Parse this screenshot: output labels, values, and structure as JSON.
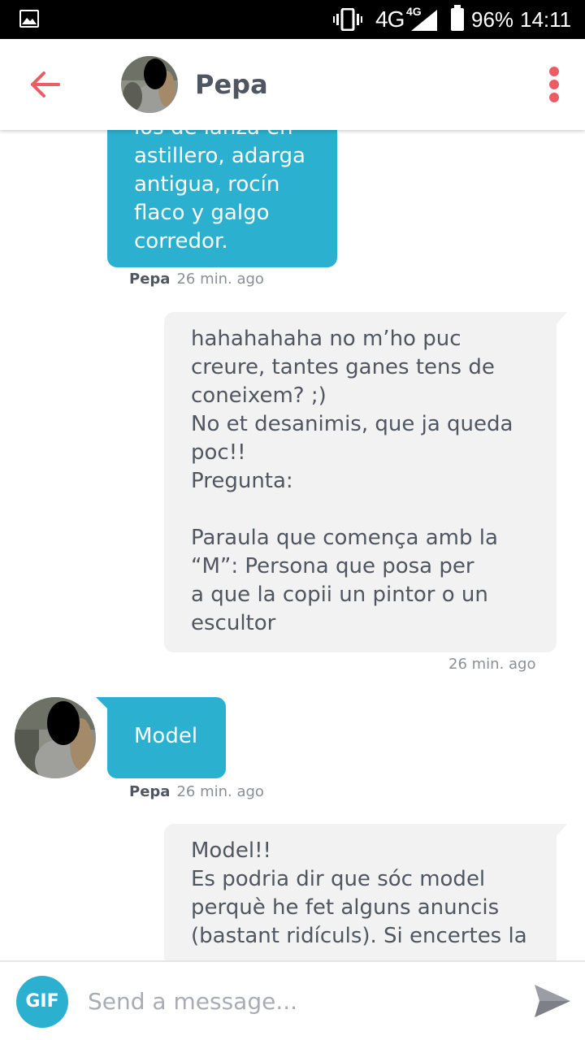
{
  "status_bar": {
    "network": "4G",
    "network_secondary": "4G",
    "battery": "96%",
    "time": "14:11",
    "icons": [
      "image-notification-icon",
      "vibrate-icon",
      "signal-icon",
      "battery-icon"
    ]
  },
  "header": {
    "contact_name": "Pepa",
    "icons": [
      "back-arrow-icon",
      "avatar",
      "more-vert-icon"
    ]
  },
  "colors": {
    "accent": "#ec5c64",
    "incoming_bubble": "#2bb1cf",
    "outgoing_bubble": "#f2f2f2",
    "text": "#505660",
    "meta": "#8a8f96"
  },
  "messages": [
    {
      "direction": "incoming",
      "lines": [
        "los de lanza en",
        "astillero, adarga",
        "antigua, rocín",
        "flaco y galgo",
        "corredor."
      ],
      "sender": "Pepa",
      "time": "26 min. ago"
    },
    {
      "direction": "outgoing",
      "lines": [
        "hahahahaha no m’ho puc",
        "creure, tantes ganes tens de",
        "coneixem? ;)",
        "No et desanimis, que ja queda",
        "poc!!",
        "Pregunta:",
        "",
        "Paraula que comença amb la",
        "“M”: Persona que posa per",
        "a que la copii un pintor o un",
        "escultor"
      ],
      "time": "26 min. ago"
    },
    {
      "direction": "incoming",
      "lines": [
        "Model"
      ],
      "sender": "Pepa",
      "time": "26 min. ago"
    },
    {
      "direction": "outgoing",
      "lines": [
        "Model!!",
        "Es podria dir que sóc model",
        "perquè he fet alguns anuncis",
        "(bastant ridículs). Si encertes la"
      ]
    }
  ],
  "input": {
    "gif_label": "GIF",
    "placeholder": "Send a message...",
    "icons": [
      "gif-button",
      "send-icon"
    ]
  }
}
